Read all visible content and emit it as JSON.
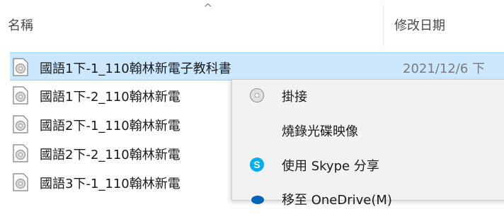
{
  "header": {
    "name_label": "名稱",
    "date_label": "修改日期",
    "sort_arrow": "^"
  },
  "files": [
    {
      "name": "國語1下-1_110翰林新電子教科書",
      "date": "2021/12/6 下",
      "selected": true,
      "icon": "disc-image-file-icon"
    },
    {
      "name": "國語1下-2_110翰林新電",
      "date": "",
      "selected": false,
      "icon": "disc-image-file-icon"
    },
    {
      "name": "國語2下-1_110翰林新電",
      "date": "",
      "selected": false,
      "icon": "disc-image-file-icon"
    },
    {
      "name": "國語2下-2_110翰林新電",
      "date": "",
      "selected": false,
      "icon": "disc-image-file-icon"
    },
    {
      "name": "國語3下-1_110翰林新電",
      "date": "",
      "selected": false,
      "icon": "disc-image-file-icon"
    }
  ],
  "context_menu": {
    "items": [
      {
        "label": "掛接",
        "icon": "disc-mount-icon"
      },
      {
        "label": "燒錄光碟映像",
        "icon": ""
      },
      {
        "label": "使用 Skype 分享",
        "icon": "skype-icon"
      },
      {
        "label": "移至 OneDrive(M)",
        "icon": "onedrive-icon"
      }
    ]
  },
  "colors": {
    "selection_bg": "#cce8ff",
    "selection_border": "#99d1ff",
    "menu_bg": "#f2f2f2",
    "skype_blue": "#00aff0",
    "onedrive_blue": "#0364b8"
  }
}
